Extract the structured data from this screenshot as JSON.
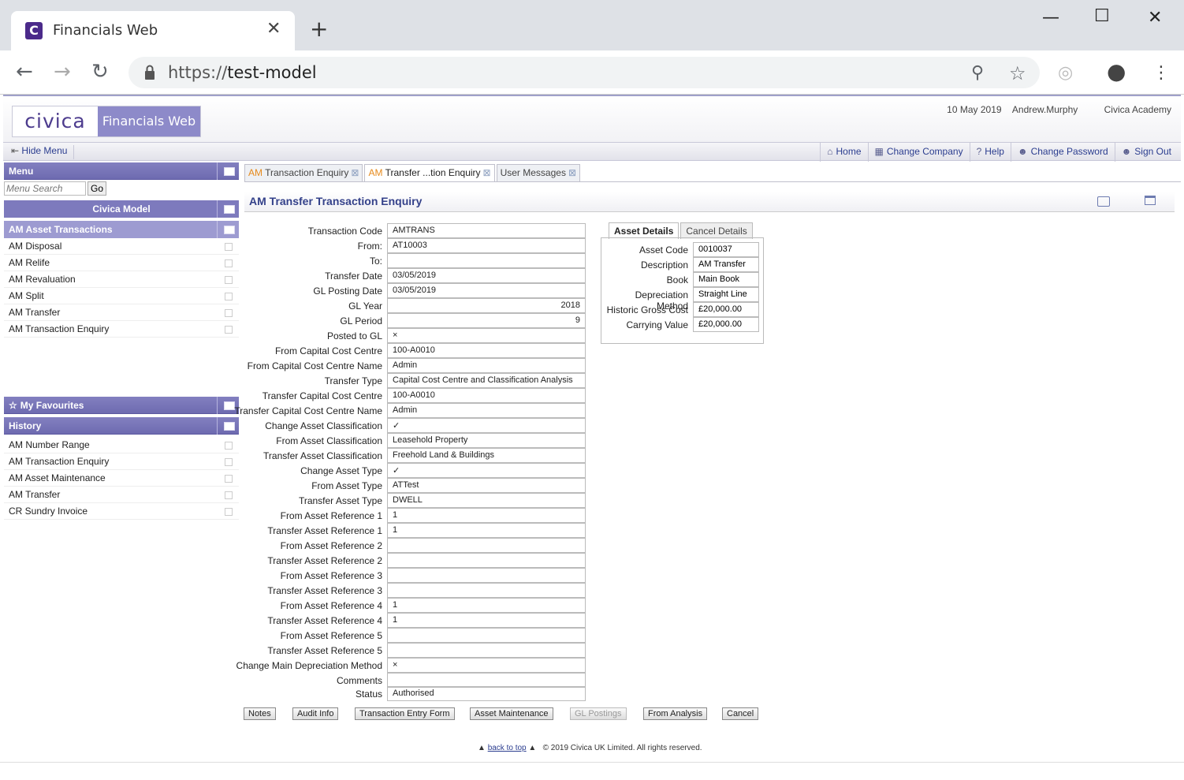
{
  "browser": {
    "tab_title": "Financials Web",
    "url_scheme": "https://",
    "url_host": "test-model"
  },
  "header": {
    "logo_text": "civica",
    "product_name": "Financials Web",
    "date": "10 May 2019",
    "user": "Andrew.Murphy",
    "company": "Civica Academy"
  },
  "menubar": {
    "hide_menu": "Hide Menu",
    "links": [
      "Home",
      "Change Company",
      "Help",
      "Change Password",
      "Sign Out"
    ]
  },
  "sidebar": {
    "menu_title": "Menu",
    "search_placeholder": "Menu Search",
    "go_label": "Go",
    "model_title": "Civica Model",
    "section_title": "AM Asset Transactions",
    "items": [
      "AM Disposal",
      "AM Relife",
      "AM Revaluation",
      "AM Split",
      "AM Transfer",
      "AM Transaction Enquiry"
    ],
    "favourites_title": "My Favourites",
    "history_title": "History",
    "history_items": [
      "AM Number Range",
      "AM Transaction Enquiry",
      "AM Asset Maintenance",
      "AM Transfer",
      "CR Sundry Invoice"
    ]
  },
  "doc_tabs": [
    {
      "prefix": "AM",
      "label": "Transaction Enquiry"
    },
    {
      "prefix": "AM",
      "label": "Transfer ...tion Enquiry"
    },
    {
      "prefix": "",
      "label": "User Messages"
    }
  ],
  "page": {
    "title": "AM Transfer Transaction Enquiry"
  },
  "fields": [
    {
      "label": "Transaction Code",
      "value": "AMTRANS"
    },
    {
      "label": "From:",
      "value": "AT10003"
    },
    {
      "label": "To:",
      "value": ""
    },
    {
      "label": "Transfer Date",
      "value": "03/05/2019"
    },
    {
      "label": "GL Posting Date",
      "value": "03/05/2019"
    },
    {
      "label": "GL Year",
      "value": "2018"
    },
    {
      "label": "GL Period",
      "value": "9"
    },
    {
      "label": "Posted to GL",
      "value": "×"
    },
    {
      "label": "From Capital Cost Centre",
      "value": "100-A0010"
    },
    {
      "label": "From Capital Cost Centre Name",
      "value": "Admin"
    },
    {
      "label": "Transfer Type",
      "value": "Capital Cost Centre and Classification Analysis"
    },
    {
      "label": "Transfer Capital Cost Centre",
      "value": "100-A0010"
    },
    {
      "label": "Transfer Capital Cost Centre Name",
      "value": "Admin"
    },
    {
      "label": "Change Asset Classification",
      "value": "✓"
    },
    {
      "label": "From Asset Classification",
      "value": "Leasehold Property"
    },
    {
      "label": "Transfer Asset Classification",
      "value": "Freehold Land & Buildings"
    },
    {
      "label": "Change Asset Type",
      "value": "✓"
    },
    {
      "label": "From Asset Type",
      "value": "ATTest"
    },
    {
      "label": "Transfer Asset Type",
      "value": "DWELL"
    },
    {
      "label": "From Asset Reference 1",
      "value": "1"
    },
    {
      "label": "Transfer Asset Reference 1",
      "value": "1"
    },
    {
      "label": "From Asset Reference 2",
      "value": ""
    },
    {
      "label": "Transfer Asset Reference 2",
      "value": ""
    },
    {
      "label": "From Asset Reference 3",
      "value": ""
    },
    {
      "label": "Transfer Asset Reference 3",
      "value": ""
    },
    {
      "label": "From Asset Reference 4",
      "value": "1"
    },
    {
      "label": "Transfer Asset Reference 4",
      "value": "1"
    },
    {
      "label": "From Asset Reference 5",
      "value": ""
    },
    {
      "label": "Transfer Asset Reference 5",
      "value": ""
    },
    {
      "label": "Change Main Depreciation Method",
      "value": "×"
    },
    {
      "label": "Comments",
      "value": ""
    },
    {
      "label": "Status",
      "value": "Authorised"
    }
  ],
  "asset_tabs": [
    "Asset Details",
    "Cancel Details"
  ],
  "asset_fields": [
    {
      "label": "Asset Code",
      "value": "0010037"
    },
    {
      "label": "Description",
      "value": "AM Transfer"
    },
    {
      "label": "Book",
      "value": "Main Book"
    },
    {
      "label": "Depreciation Method",
      "value": "Straight Line"
    },
    {
      "label": "Historic Gross Cost",
      "value": "£20,000.00"
    },
    {
      "label": "Carrying Value",
      "value": "£20,000.00"
    }
  ],
  "buttons": [
    "Notes",
    "Audit Info",
    "Transaction Entry Form",
    "Asset Maintenance",
    "GL Postings",
    "From Analysis",
    "Cancel"
  ],
  "footer": {
    "back_to_top": "back to top",
    "copyright": "© 2019 Civica UK Limited. All rights reserved."
  },
  "colors": {
    "brand_purple": "#8d8ac9",
    "header_link": "#2b3d8f",
    "tab_prefix": "#e68a1c"
  }
}
